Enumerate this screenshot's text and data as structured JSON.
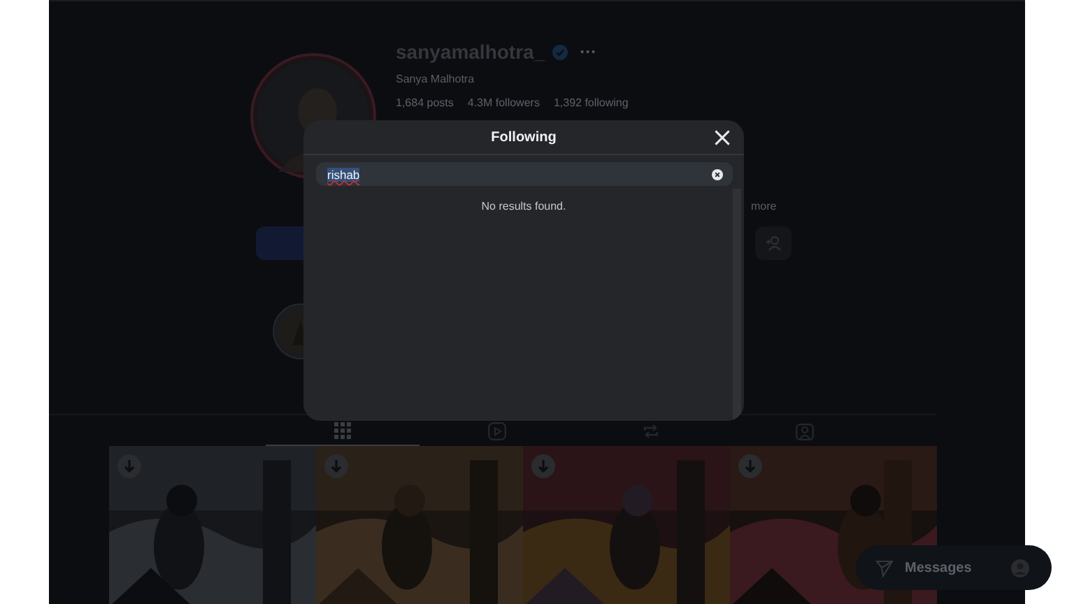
{
  "profile": {
    "username": "sanyamalhotra_",
    "verified": true,
    "more_icon": "···",
    "display_name": "Sanya Malhotra",
    "stats": [
      "1,684 posts",
      "4.3M followers",
      "1,392 following"
    ],
    "bio_more": "more"
  },
  "tabs": [
    {
      "kind": "grid",
      "selected": true
    },
    {
      "kind": "reels",
      "selected": false
    },
    {
      "kind": "reposts",
      "selected": false
    },
    {
      "kind": "tagged",
      "selected": false
    }
  ],
  "modal": {
    "title": "Following",
    "search": {
      "value": "rishab"
    },
    "empty_message": "No results found."
  },
  "messages": {
    "label": "Messages"
  }
}
